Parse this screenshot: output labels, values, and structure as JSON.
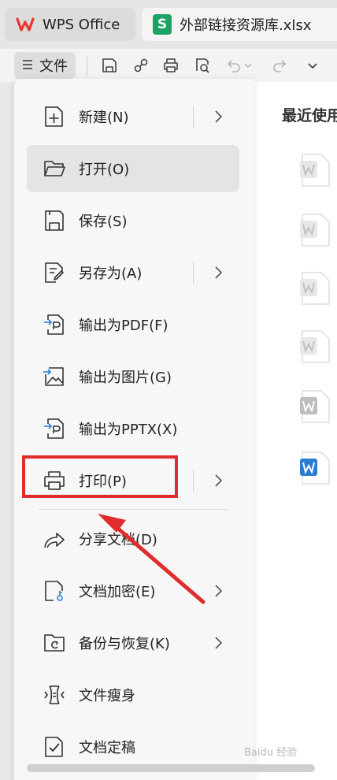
{
  "tabs": {
    "app": "WPS Office",
    "file": "外部链接资源库.xlsx"
  },
  "toolbar": {
    "file_menu_label": "文件",
    "xls_letter": "S"
  },
  "recent": {
    "title": "最近使用"
  },
  "menu": {
    "items": [
      {
        "label": "新建(N)",
        "has_submenu": true
      },
      {
        "label": "打开(O)",
        "active": true
      },
      {
        "label": "保存(S)"
      },
      {
        "label": "另存为(A)",
        "has_submenu": true
      },
      {
        "label": "输出为PDF(F)"
      },
      {
        "label": "输出为图片(G)"
      },
      {
        "label": "输出为PPTX(X)"
      },
      {
        "label": "打印(P)",
        "has_submenu": true,
        "highlighted": true
      },
      {
        "label": "分享文档(D)"
      },
      {
        "label": "文档加密(E)",
        "has_submenu": true
      },
      {
        "label": "备份与恢复(K)",
        "has_submenu": true
      },
      {
        "label": "文件瘦身"
      },
      {
        "label": "文档定稿"
      }
    ]
  },
  "colors": {
    "highlight": "#e02c2c",
    "wps_brand": "#e8372f",
    "xls_green": "#1aa463",
    "word_blue": "#2b7cd3"
  },
  "watermark": "Baidu 经验"
}
